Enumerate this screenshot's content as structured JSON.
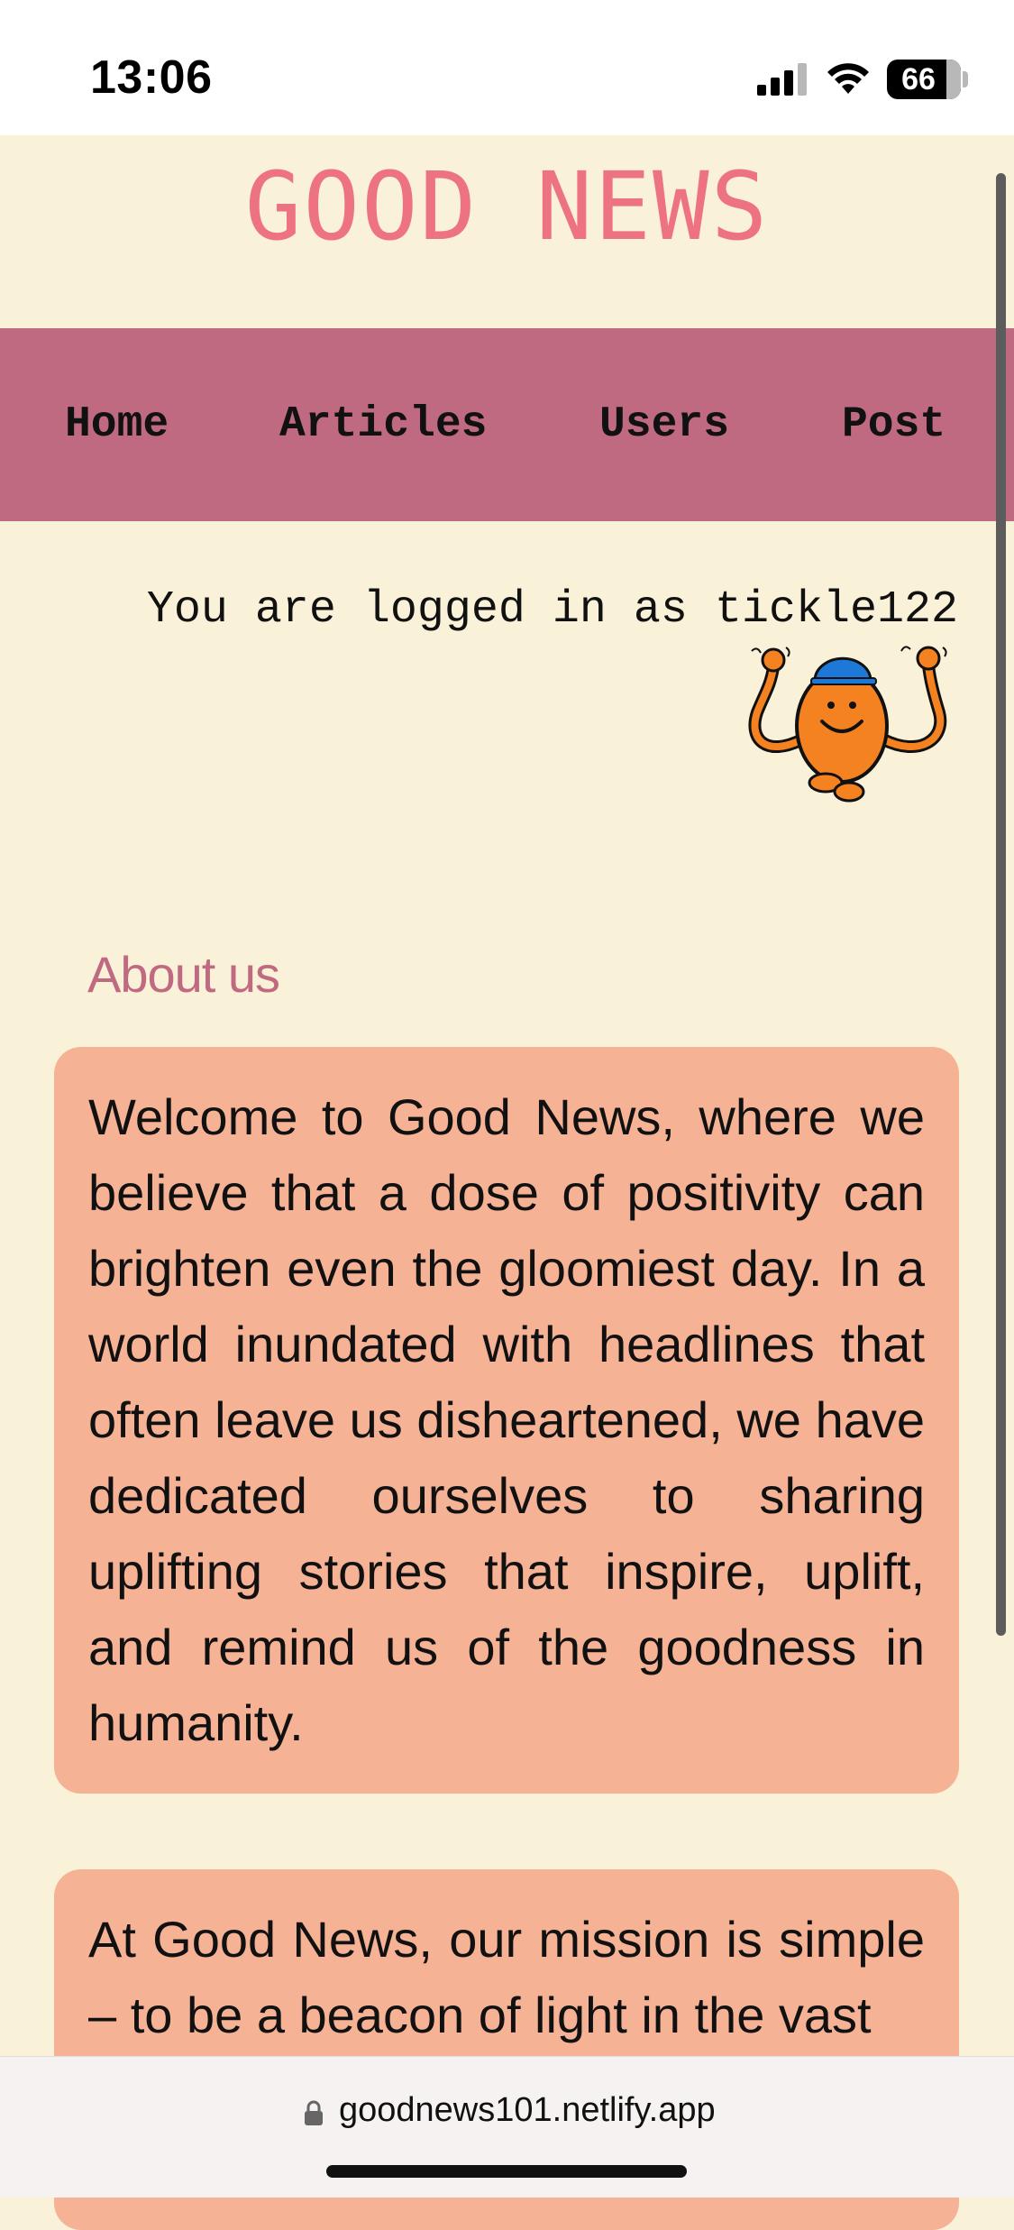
{
  "status_bar": {
    "time": "13:06",
    "battery": "66",
    "icons": [
      "signal-icon",
      "wifi-icon",
      "battery-icon"
    ]
  },
  "header": {
    "title": "GOOD NEWS"
  },
  "nav": {
    "items": [
      {
        "label": "Home"
      },
      {
        "label": "Articles"
      },
      {
        "label": "Users"
      },
      {
        "label": "Post"
      }
    ]
  },
  "login": {
    "text": "You are logged in as tickle122",
    "avatar": "mr-tickle-mascot-icon"
  },
  "about": {
    "heading": "About us",
    "paragraphs": [
      "Welcome to Good News, where we believe that a dose of positivity can brighten even the gloomiest day. In a world inundated with headlines that often leave us disheartened, we have dedicated ourselves to sharing uplifting stories that inspire, uplift, and remind us of the goodness in humanity.",
      "At Good News, our mission is simple – to be a beacon of light in the vast"
    ]
  },
  "browser": {
    "url": "goodnews101.netlify.app"
  },
  "colors": {
    "background": "#FAF1D9",
    "title": "#EE7380",
    "nav": "#C06A82",
    "card": "#F5B294",
    "heading": "#C06A82"
  }
}
